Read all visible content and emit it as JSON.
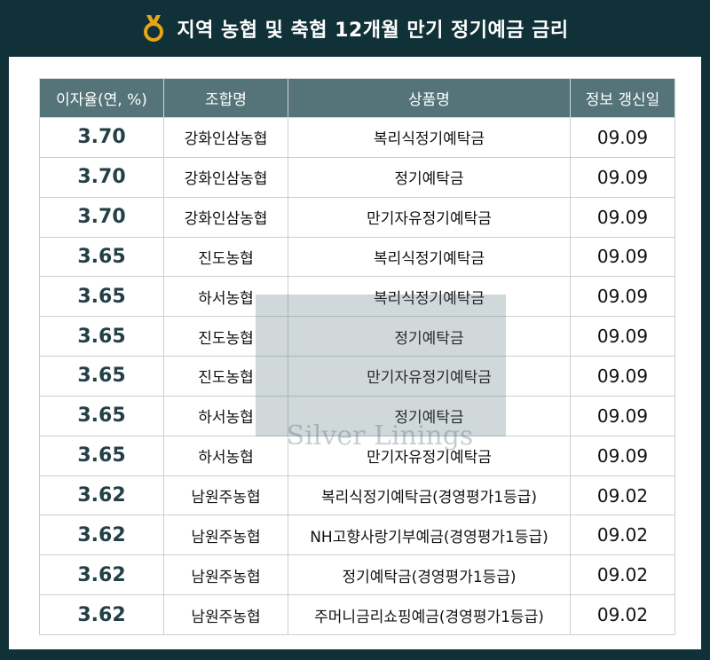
{
  "header": {
    "title": "지역 농협 및 축협 12개월 만기 정기예금 금리",
    "icon": "medal-icon",
    "icon_color": "#e8a317"
  },
  "table": {
    "columns": [
      "이자율(연, %)",
      "조합명",
      "상품명",
      "정보 갱신일"
    ],
    "rows": [
      {
        "rate": "3.70",
        "union": "강화인삼농협",
        "product": "복리식정기예탁금",
        "date": "09.09"
      },
      {
        "rate": "3.70",
        "union": "강화인삼농협",
        "product": "정기예탁금",
        "date": "09.09"
      },
      {
        "rate": "3.70",
        "union": "강화인삼농협",
        "product": "만기자유정기예탁금",
        "date": "09.09"
      },
      {
        "rate": "3.65",
        "union": "진도농협",
        "product": "복리식정기예탁금",
        "date": "09.09"
      },
      {
        "rate": "3.65",
        "union": "하서농협",
        "product": "복리식정기예탁금",
        "date": "09.09"
      },
      {
        "rate": "3.65",
        "union": "진도농협",
        "product": "정기예탁금",
        "date": "09.09"
      },
      {
        "rate": "3.65",
        "union": "진도농협",
        "product": "만기자유정기예탁금",
        "date": "09.09"
      },
      {
        "rate": "3.65",
        "union": "하서농협",
        "product": "정기예탁금",
        "date": "09.09"
      },
      {
        "rate": "3.65",
        "union": "하서농협",
        "product": "만기자유정기예탁금",
        "date": "09.09"
      },
      {
        "rate": "3.62",
        "union": "남원주농협",
        "product": "복리식정기예탁금(경영평가1등급)",
        "date": "09.02"
      },
      {
        "rate": "3.62",
        "union": "남원주농협",
        "product": "NH고향사랑기부예금(경영평가1등급)",
        "date": "09.02"
      },
      {
        "rate": "3.62",
        "union": "남원주농협",
        "product": "정기예탁금(경영평가1등급)",
        "date": "09.02"
      },
      {
        "rate": "3.62",
        "union": "남원주농협",
        "product": "주머니금리쇼핑예금(경영평가1등급)",
        "date": "09.02"
      }
    ]
  },
  "watermark": {
    "text": "Silver Linings"
  }
}
